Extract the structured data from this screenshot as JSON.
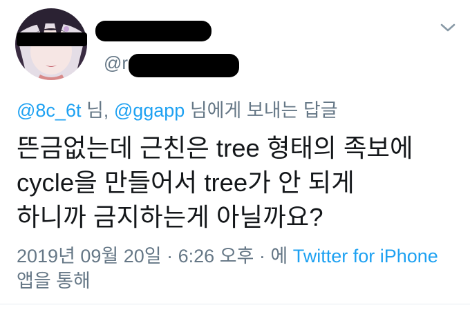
{
  "tweet": {
    "handle_prefix": "@r",
    "menu_icon": "chevron-down-icon",
    "reply_to": {
      "mention1": "@8c_6t",
      "suffix1": " 님, ",
      "mention2": "@ggapp",
      "suffix2": " 님에게 보내는 답글"
    },
    "body_lines": [
      "뜬금없는데 근친은 tree 형태의 족보에",
      "cycle을 만들어서 tree가 안 되게",
      "하니까 금지하는게 아닐까요?"
    ],
    "meta": {
      "timestamp": "2019년 09월 20일 · 6:26 오후 · 에 ",
      "source": "Twitter for iPhone",
      "via": "앱을 통해"
    },
    "colors": {
      "link": "#1da1f2",
      "secondary": "#657786",
      "text": "#14171a",
      "censor": "#000000"
    }
  }
}
